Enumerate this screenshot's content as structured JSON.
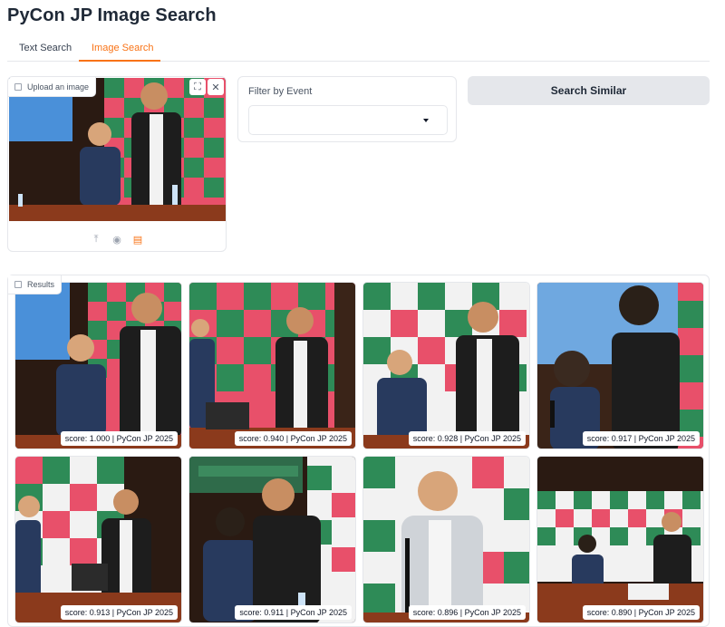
{
  "app": {
    "title": "PyCon JP Image Search"
  },
  "tabs": [
    {
      "label": "Text Search",
      "active": false
    },
    {
      "label": "Image Search",
      "active": true
    }
  ],
  "upload": {
    "label": "Upload an image",
    "tools": [
      "fullscreen-icon",
      "close-icon"
    ],
    "actions": [
      "upload-icon",
      "webcam-icon",
      "clipboard-icon"
    ]
  },
  "filter": {
    "label": "Filter by Event",
    "selected": ""
  },
  "search_button": {
    "label": "Search Similar"
  },
  "results": {
    "label": "Results",
    "items": [
      {
        "caption": "score: 1.000 | PyCon JP 2025"
      },
      {
        "caption": "score: 0.940 | PyCon JP 2025"
      },
      {
        "caption": "score: 0.928 | PyCon JP 2025"
      },
      {
        "caption": "score: 0.917 | PyCon JP 2025"
      },
      {
        "caption": "score: 0.913 | PyCon JP 2025"
      },
      {
        "caption": "score: 0.911 | PyCon JP 2025"
      },
      {
        "caption": "score: 0.896 | PyCon JP 2025"
      },
      {
        "caption": "score: 0.890 | PyCon JP 2025"
      }
    ]
  },
  "colors": {
    "accent": "#f97316",
    "backdrop_green": "#2e8b57",
    "backdrop_pink": "#e8506a",
    "stage_wood": "#8b3a1c"
  }
}
